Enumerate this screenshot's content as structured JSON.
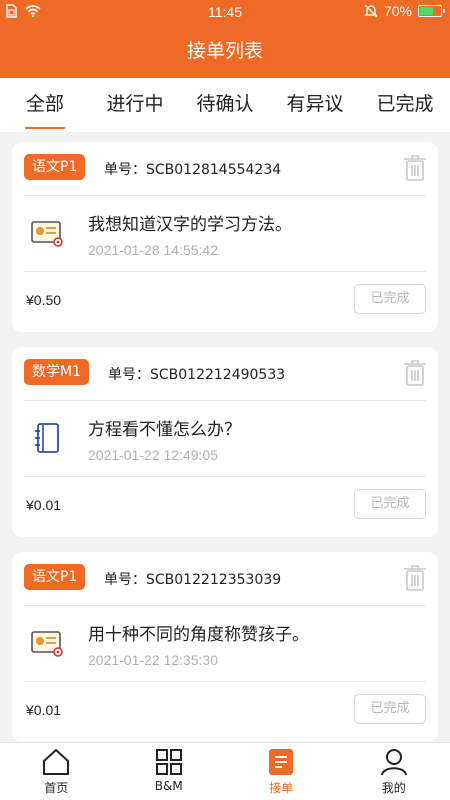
{
  "status_bar": {
    "time": "11:45",
    "battery": "70%",
    "battery_level": 0.7
  },
  "header": {
    "title": "接单列表"
  },
  "tabs": [
    {
      "label": "全部",
      "active": true
    },
    {
      "label": "进行中"
    },
    {
      "label": "待确认"
    },
    {
      "label": "有异议"
    },
    {
      "label": "已完成"
    }
  ],
  "orders": [
    {
      "tag": "语文P1",
      "order_no": "单号：SCB012814554234",
      "title": "我想知道汉字的学习方法。",
      "time": "2021-01-28 14:55:42",
      "price": "¥0.50",
      "status": "已完成",
      "icon": "certificate-icon"
    },
    {
      "tag": "数学M1",
      "order_no": "单号：SCB012212490533",
      "title": "方程看不懂怎么办？",
      "time": "2021-01-22 12:49:05",
      "price": "¥0.01",
      "status": "已完成",
      "icon": "notebook-icon"
    },
    {
      "tag": "语文P1",
      "order_no": "单号：SCB012212353039",
      "title": "用十种不同的角度称赞孩子。",
      "time": "2021-01-22 12:35:30",
      "price": "¥0.01",
      "status": "已完成",
      "icon": "certificate-icon"
    }
  ],
  "bottom_nav": [
    {
      "label": "首页",
      "icon": "home-icon"
    },
    {
      "label": "B&M",
      "icon": "grid-icon"
    },
    {
      "label": "接单",
      "icon": "orders-icon",
      "active": true
    },
    {
      "label": "我的",
      "icon": "profile-icon"
    }
  ],
  "colors": {
    "brand": "#ef6a27"
  }
}
